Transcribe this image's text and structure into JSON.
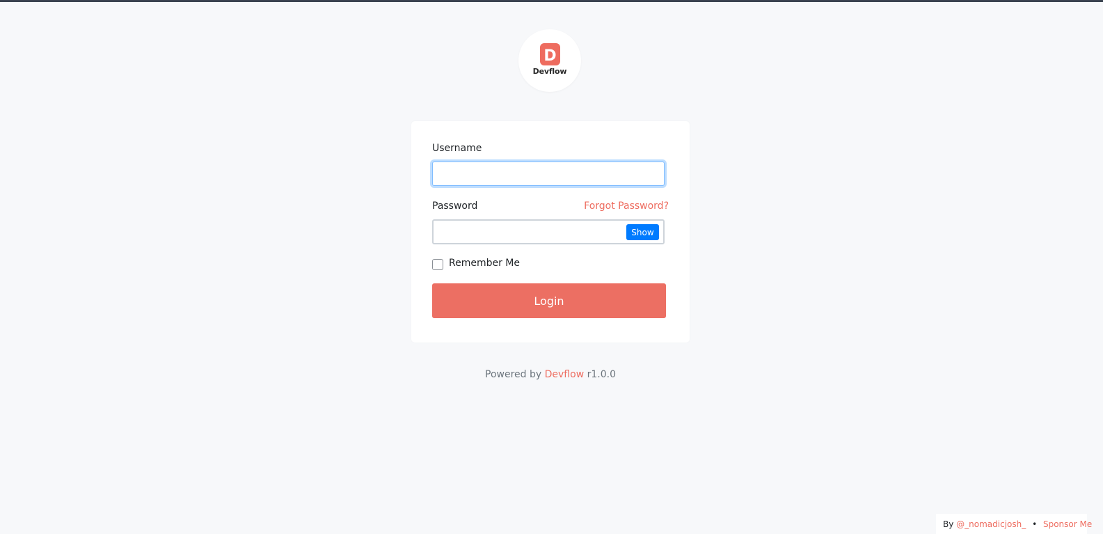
{
  "logo": {
    "letter": "D",
    "wordmark": "Devflow",
    "brand_color": "#ee6c5f"
  },
  "form": {
    "username_label": "Username",
    "username_value": "",
    "password_label": "Password",
    "password_value": "",
    "forgot_password_link": "Forgot Password?",
    "show_button_label": "Show",
    "remember_me_label": "Remember Me",
    "remember_me_checked": false,
    "login_button_label": "Login"
  },
  "footer": {
    "powered_by_prefix": "Powered by",
    "powered_by_link": "Devflow",
    "version": "r1.0.0"
  },
  "credit": {
    "by_prefix": "By",
    "author_handle": "@_nomadicjosh_",
    "separator": "•",
    "sponsor_link": "Sponsor Me"
  },
  "colors": {
    "accent": "#ee6c5f",
    "login_button": "#ec6f63",
    "show_button": "#007bff",
    "background": "#f7f8fa",
    "top_border": "#3b4350"
  }
}
